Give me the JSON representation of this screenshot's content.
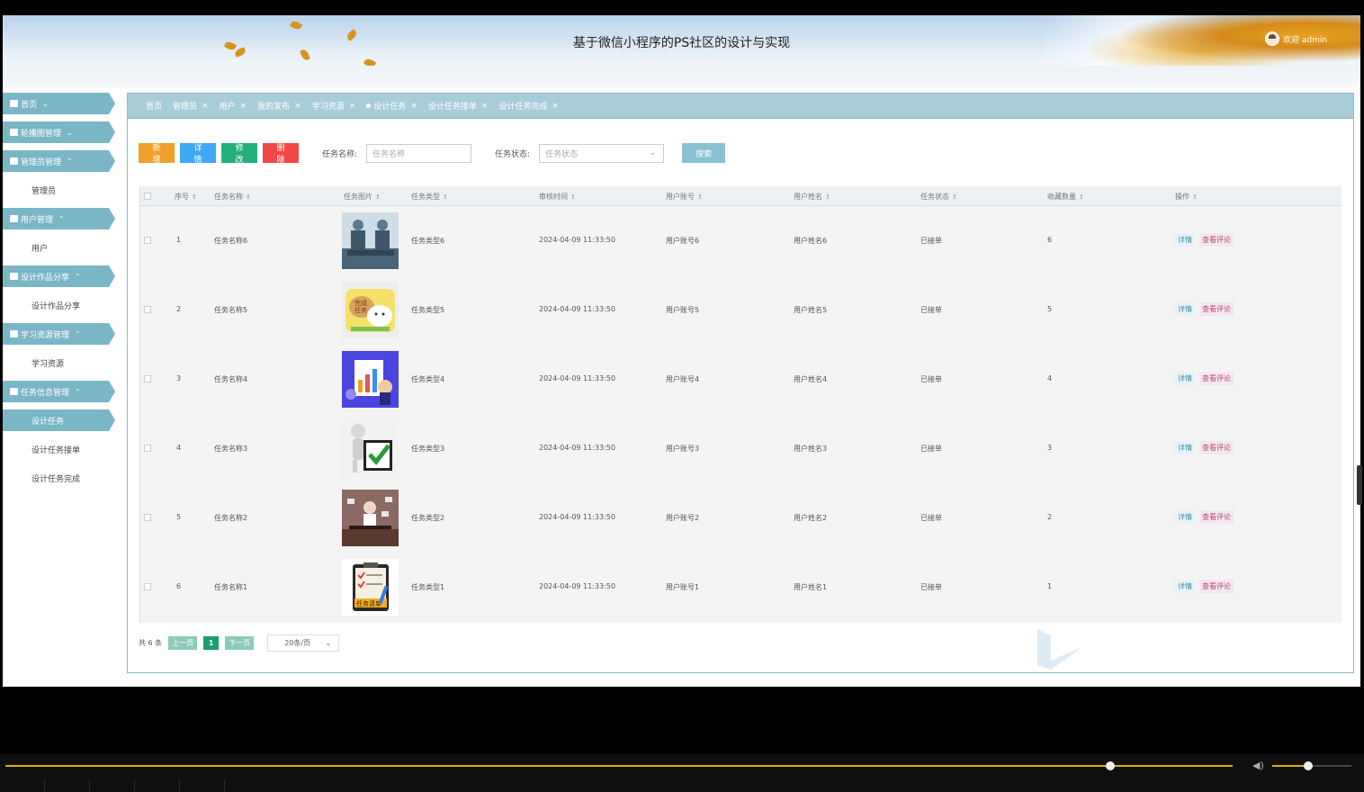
{
  "header": {
    "title": "基于微信小程序的PS社区的设计与实现",
    "welcome": "欢迎 admin"
  },
  "sidebar": {
    "items": [
      {
        "type": "head",
        "label": "首页",
        "chev": "⌄",
        "icon": "home-icon"
      },
      {
        "type": "head",
        "label": "轮播图管理",
        "chev": "⌄",
        "icon": "carousel-icon"
      },
      {
        "type": "head",
        "label": "管理员管理",
        "chev": "⌃",
        "icon": "admin-icon"
      },
      {
        "type": "sub",
        "label": "管理员"
      },
      {
        "type": "head",
        "label": "用户管理",
        "chev": "⌃",
        "icon": "user-icon"
      },
      {
        "type": "sub",
        "label": "用户"
      },
      {
        "type": "head",
        "label": "设计作品分享",
        "chev": "⌃",
        "icon": "grid-icon"
      },
      {
        "type": "sub",
        "label": "设计作品分享"
      },
      {
        "type": "head",
        "label": "学习资源管理",
        "chev": "⌃",
        "icon": "book-icon"
      },
      {
        "type": "sub",
        "label": "学习资源"
      },
      {
        "type": "head",
        "label": "任务信息管理",
        "chev": "⌃",
        "icon": "task-icon"
      },
      {
        "type": "sub",
        "label": "设计任务",
        "active": true
      },
      {
        "type": "sub",
        "label": "设计任务接单"
      },
      {
        "type": "sub",
        "label": "设计任务完成"
      }
    ]
  },
  "tabs": [
    {
      "label": "首页",
      "closable": false
    },
    {
      "label": "管理员",
      "closable": true
    },
    {
      "label": "用户",
      "closable": true
    },
    {
      "label": "我的发布",
      "closable": true
    },
    {
      "label": "学习资源",
      "closable": true
    },
    {
      "label": "设计任务",
      "closable": true,
      "active": true
    },
    {
      "label": "设计任务接单",
      "closable": true
    },
    {
      "label": "设计任务完成",
      "closable": true
    }
  ],
  "toolbar": {
    "add": "新增",
    "detail": "详情",
    "edit": "修改",
    "delete": "删除",
    "name_label": "任务名称:",
    "name_placeholder": "任务名称",
    "status_label": "任务状态:",
    "status_placeholder": "任务状态",
    "search": "搜索"
  },
  "table": {
    "headers": [
      "序号",
      "任务名称",
      "任务图片",
      "任务类型",
      "审核时间",
      "用户账号",
      "用户姓名",
      "任务状态",
      "收藏数量",
      "操作"
    ],
    "rows": [
      {
        "no": "1",
        "name": "任务名称6",
        "type": "任务类型6",
        "time": "2024-04-09 11:33:50",
        "account": "用户账号6",
        "uname": "用户姓名6",
        "status": "已接单",
        "fav": "6",
        "img": "img-meeting"
      },
      {
        "no": "2",
        "name": "任务名称5",
        "type": "任务类型5",
        "time": "2024-04-09 11:33:50",
        "account": "用户账号5",
        "uname": "用户姓名5",
        "status": "已接单",
        "fav": "5",
        "img": "img-done"
      },
      {
        "no": "3",
        "name": "任务名称4",
        "type": "任务类型4",
        "time": "2024-04-09 11:33:50",
        "account": "用户账号4",
        "uname": "用户姓名4",
        "status": "已接单",
        "fav": "4",
        "img": "img-chart"
      },
      {
        "no": "4",
        "name": "任务名称3",
        "type": "任务类型3",
        "time": "2024-04-09 11:33:50",
        "account": "用户账号3",
        "uname": "用户姓名3",
        "status": "已接单",
        "fav": "3",
        "img": "img-check"
      },
      {
        "no": "5",
        "name": "任务名称2",
        "type": "任务类型2",
        "time": "2024-04-09 11:33:50",
        "account": "用户账号2",
        "uname": "用户姓名2",
        "status": "已接单",
        "fav": "2",
        "img": "img-busy"
      },
      {
        "no": "6",
        "name": "任务名称1",
        "type": "任务类型1",
        "time": "2024-04-09 11:33:50",
        "account": "用户账号1",
        "uname": "用户姓名1",
        "status": "已接单",
        "fav": "1",
        "img": "img-list"
      }
    ],
    "op_detail": "详情",
    "op_comment": "查看评论",
    "img_caption_done": "完成任务",
    "img_caption_list": "任务清单"
  },
  "pagination": {
    "total": "共 6 条",
    "prev": "上一页",
    "current": "1",
    "next": "下一页",
    "size": "20条/页"
  },
  "colors": {
    "accent": "#7ab6c6",
    "add": "#f0a02a",
    "detail": "#3fa9f5",
    "edit": "#23b07a",
    "delete": "#f04848",
    "search": "#89c3d2",
    "progress": "#d6b400"
  },
  "player": {
    "progress": 0.9,
    "volume": 0.45
  }
}
